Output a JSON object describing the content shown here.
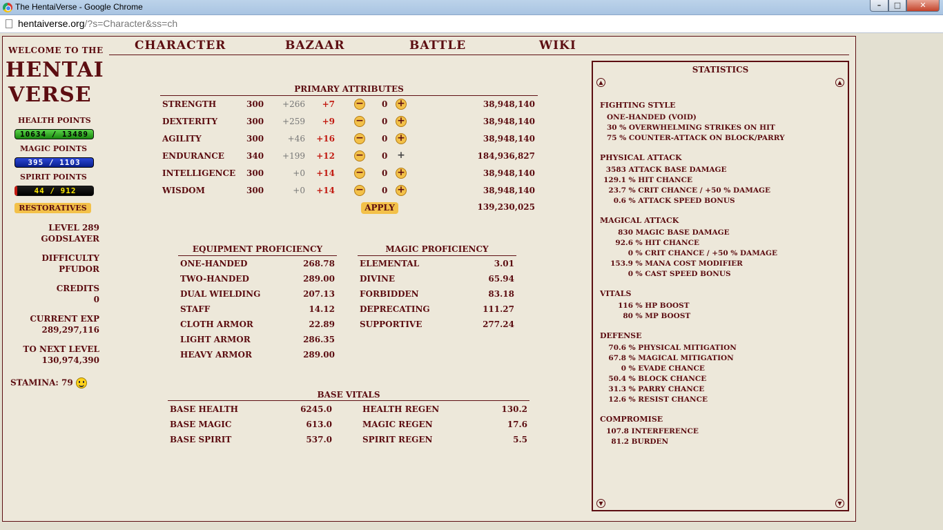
{
  "browser": {
    "title": "The HentaiVerse - Google Chrome",
    "url_host": "hentaiverse.org",
    "url_path": "/?s=Character&ss=ch",
    "min": "–",
    "max": "□",
    "close": "✕"
  },
  "nav": [
    "CHARACTER",
    "BAZAAR",
    "BATTLE",
    "WIKI"
  ],
  "left": {
    "welcome": "WELCOME TO THE",
    "logo1": "HENTAI",
    "logo2": "VERSE",
    "health_label": "HEALTH POINTS",
    "health": "10634 / 13489",
    "magic_label": "MAGIC POINTS",
    "magic": "395 / 1103",
    "spirit_label": "SPIRIT POINTS",
    "spirit": "44 / 912",
    "restoratives": "RESTORATIVES",
    "level": "LEVEL 289",
    "title": "GODSLAYER",
    "difficulty_label": "DIFFICULTY",
    "difficulty": "PFUDOR",
    "credits_label": "CREDITS",
    "credits": "0",
    "exp_label": "CURRENT EXP",
    "exp": "289,297,116",
    "next_label": "TO NEXT LEVEL",
    "next": "130,974,390",
    "stamina": "STAMINA: 79"
  },
  "primary": {
    "title": "PRIMARY ATTRIBUTES",
    "rows": [
      {
        "name": "STRENGTH",
        "base": "300",
        "mod": "+266",
        "bonus": "+7",
        "val": "0",
        "exp": "38,948,140"
      },
      {
        "name": "DEXTERITY",
        "base": "300",
        "mod": "+259",
        "bonus": "+9",
        "val": "0",
        "exp": "38,948,140"
      },
      {
        "name": "AGILITY",
        "base": "300",
        "mod": "+46",
        "bonus": "+16",
        "val": "0",
        "exp": "38,948,140"
      },
      {
        "name": "ENDURANCE",
        "base": "340",
        "mod": "+199",
        "bonus": "+12",
        "val": "0",
        "exp": "184,936,827"
      },
      {
        "name": "INTELLIGENCE",
        "base": "300",
        "mod": "+0",
        "bonus": "+14",
        "val": "0",
        "exp": "38,948,140"
      },
      {
        "name": "WISDOM",
        "base": "300",
        "mod": "+0",
        "bonus": "+14",
        "val": "0",
        "exp": "38,948,140"
      }
    ],
    "apply": "APPLY",
    "total": "139,230,025"
  },
  "equip": {
    "title": "EQUIPMENT PROFICIENCY",
    "rows": [
      {
        "name": "ONE-HANDED",
        "val": "268.78"
      },
      {
        "name": "TWO-HANDED",
        "val": "289.00"
      },
      {
        "name": "DUAL WIELDING",
        "val": "207.13"
      },
      {
        "name": "STAFF",
        "val": "14.12"
      },
      {
        "name": "CLOTH ARMOR",
        "val": "22.89"
      },
      {
        "name": "LIGHT ARMOR",
        "val": "286.35"
      },
      {
        "name": "HEAVY ARMOR",
        "val": "289.00"
      }
    ]
  },
  "magic": {
    "title": "MAGIC PROFICIENCY",
    "rows": [
      {
        "name": "ELEMENTAL",
        "val": "3.01"
      },
      {
        "name": "DIVINE",
        "val": "65.94"
      },
      {
        "name": "FORBIDDEN",
        "val": "83.18"
      },
      {
        "name": "DEPRECATING",
        "val": "111.27"
      },
      {
        "name": "SUPPORTIVE",
        "val": "277.24"
      }
    ]
  },
  "vitals": {
    "title": "BASE VITALS",
    "rows": [
      {
        "a": "BASE HEALTH",
        "av": "6245.0",
        "b": "HEALTH REGEN",
        "bv": "130.2"
      },
      {
        "a": "BASE MAGIC",
        "av": "613.0",
        "b": "MAGIC REGEN",
        "bv": "17.6"
      },
      {
        "a": "BASE SPIRIT",
        "av": "537.0",
        "b": "SPIRIT REGEN",
        "bv": "5.5"
      }
    ]
  },
  "stats": {
    "title": "STATISTICS",
    "fighting_style": "FIGHTING STYLE",
    "fs1": "ONE-HANDED (VOID)",
    "fs2": "30 % OVERWHELMING STRIKES ON HIT",
    "fs3": "75 % COUNTER-ATTACK ON BLOCK/PARRY",
    "physical": "PHYSICAL ATTACK",
    "p1n": "3583",
    "p1": "ATTACK BASE DAMAGE",
    "p2n": "129.1",
    "p2": "% HIT CHANCE",
    "p3n": "23.7",
    "p3": "% CRIT CHANCE / +50 % DAMAGE",
    "p4n": "0.6",
    "p4": "% ATTACK SPEED BONUS",
    "magical": "MAGICAL ATTACK",
    "m1n": "830",
    "m1": "MAGIC BASE DAMAGE",
    "m2n": "92.6",
    "m2": "% HIT CHANCE",
    "m3n": "0",
    "m3": "% CRIT CHANCE / +50 % DAMAGE",
    "m4n": "153.9",
    "m4": "% MANA COST MODIFIER",
    "m5n": "0",
    "m5": "% CAST SPEED BONUS",
    "vitals": "VITALS",
    "v1n": "116",
    "v1": "% HP BOOST",
    "v2n": "80",
    "v2": "% MP BOOST",
    "defense": "DEFENSE",
    "d1n": "70.6",
    "d1": "% PHYSICAL MITIGATION",
    "d2n": "67.8",
    "d2": "% MAGICAL MITIGATION",
    "d3n": "0",
    "d3": "% EVADE CHANCE",
    "d4n": "50.4",
    "d4": "% BLOCK CHANCE",
    "d5n": "31.3",
    "d5": "% PARRY CHANCE",
    "d6n": "12.6",
    "d6": "% RESIST CHANCE",
    "compromise": "COMPROMISE",
    "c1n": "107.8",
    "c1": "INTERFERENCE",
    "c2n": "81.2",
    "c2": "BURDEN"
  }
}
